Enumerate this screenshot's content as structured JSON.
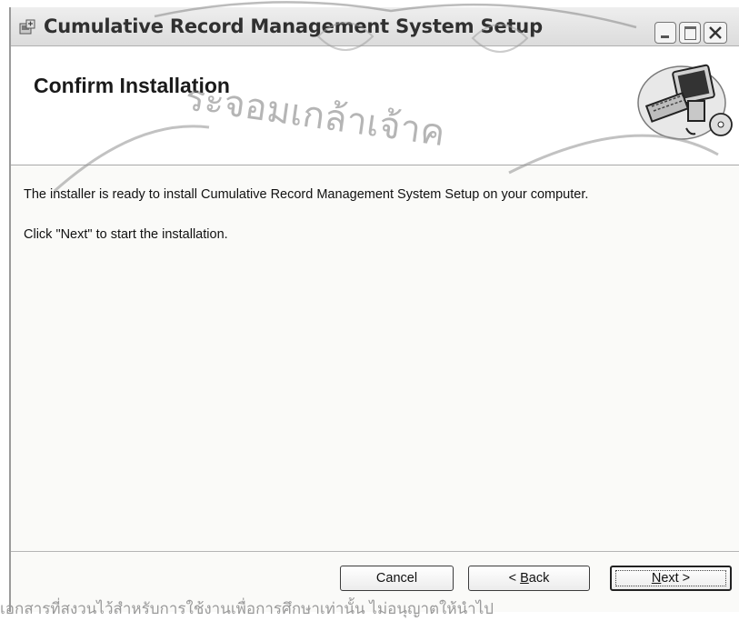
{
  "window": {
    "title": "Cumulative Record Management System Setup"
  },
  "header": {
    "title": "Confirm Installation"
  },
  "body": {
    "line1": "The installer is ready to install Cumulative Record Management System Setup on your computer.",
    "line2": "Click \"Next\" to start the installation."
  },
  "buttons": {
    "cancel": "Cancel",
    "back_prefix": "< ",
    "back_accel": "B",
    "back_rest": "ack",
    "next_accel": "N",
    "next_rest": "ext >"
  },
  "watermark": {
    "text": "ระจอมเกล้าเจ้าค",
    "footer_note": "เอกสารที่สงวนไว้สำหรับการใช้งานเพื่อการศึกษาเท่านั้น ไม่อนุญาตให้นำไป"
  },
  "icons": {
    "app": "installer-icon",
    "header_art": "computer-icon",
    "minimize": "minimize-icon",
    "maximize": "maximize-icon",
    "close": "close-icon"
  }
}
